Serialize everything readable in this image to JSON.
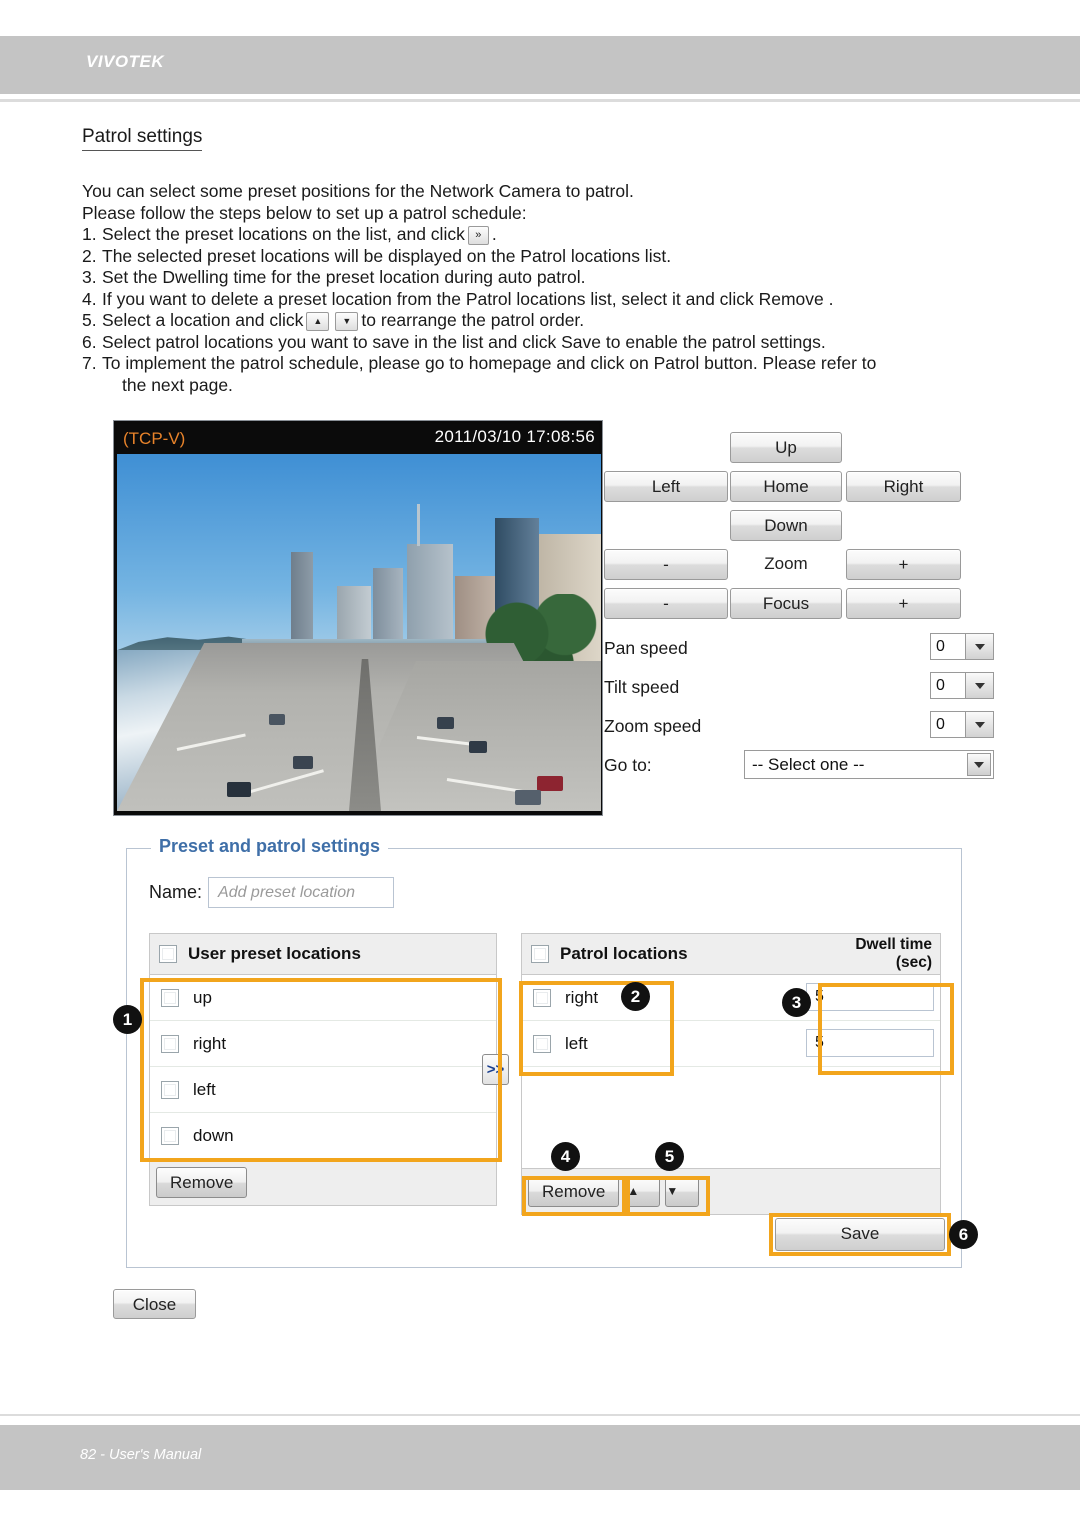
{
  "header": {
    "brand": "VIVOTEK"
  },
  "doc": {
    "section_title": "Patrol settings",
    "intro_line1": "You can select some preset positions for the Network Camera to patrol.",
    "intro_line2": "Please follow the steps below to set up a patrol schedule:",
    "steps": [
      {
        "num": "1.",
        "before": "Select the preset locations on the list, and click",
        "icon": "»",
        "after": "."
      },
      {
        "num": "2.",
        "before": "The selected preset locations will be displayed on the Patrol locations   list.",
        "icon": "",
        "after": ""
      },
      {
        "num": "3.",
        "before": "Set the Dwelling time  for the preset location during auto patrol.",
        "icon": "",
        "after": ""
      },
      {
        "num": "4.",
        "before": "If you want to delete a preset location from the Patrol locations list, select it and click Remove .",
        "icon": "",
        "after": ""
      },
      {
        "num": "5.",
        "before": "Select a location and click",
        "icon": "▲▼",
        "after": "to rearrange the patrol order."
      },
      {
        "num": "6.",
        "before": "Select patrol locations you want to save in the list and click Save to enable the patrol settings.",
        "icon": "",
        "after": ""
      },
      {
        "num": "7.",
        "before": "To implement the patrol schedule, please go to homepage and click on Patrol  button. Please refer to",
        "icon": "",
        "after": ""
      }
    ],
    "step7_cont": "the next page."
  },
  "video": {
    "osd_stream": "(TCP-V)",
    "osd_datetime": "2011/03/10  17:08:56",
    "osd_color": "#e8832a"
  },
  "ptz": {
    "up": "Up",
    "left": "Left",
    "home": "Home",
    "right": "Right",
    "down": "Down",
    "zoom_minus": "-",
    "zoom_label": "Zoom",
    "zoom_plus": "+",
    "focus_minus": "-",
    "focus_label": "Focus",
    "focus_plus": "+",
    "pan_speed_label": "Pan speed",
    "pan_speed_value": "0",
    "tilt_speed_label": "Tilt speed",
    "tilt_speed_value": "0",
    "zoom_speed_label": "Zoom speed",
    "zoom_speed_value": "0",
    "goto_label": "Go to:",
    "goto_value": "-- Select one --"
  },
  "panel": {
    "legend": "Preset and patrol settings",
    "name_label": "Name:",
    "name_placeholder": "Add preset location",
    "user_list_title": "User preset locations",
    "user_items": [
      {
        "label": "up"
      },
      {
        "label": "right"
      },
      {
        "label": "left"
      },
      {
        "label": "down"
      }
    ],
    "user_remove": "Remove",
    "transfer": ">>",
    "patrol_list_title": "Patrol locations",
    "dwell_head_line1": "Dwell time",
    "dwell_head_line2": "(sec)",
    "patrol_items": [
      {
        "label": "right",
        "dwell": "5"
      },
      {
        "label": "left",
        "dwell": "5"
      }
    ],
    "patrol_remove": "Remove",
    "move_up": "▲",
    "move_down": "▼",
    "save": "Save",
    "close": "Close",
    "highlight_color": "#f2a51c"
  },
  "markers": {
    "m1": "1",
    "m2": "2",
    "m3": "3",
    "m4": "4",
    "m5": "5",
    "m6": "6"
  },
  "footer": {
    "text": "82 - User's Manual"
  }
}
